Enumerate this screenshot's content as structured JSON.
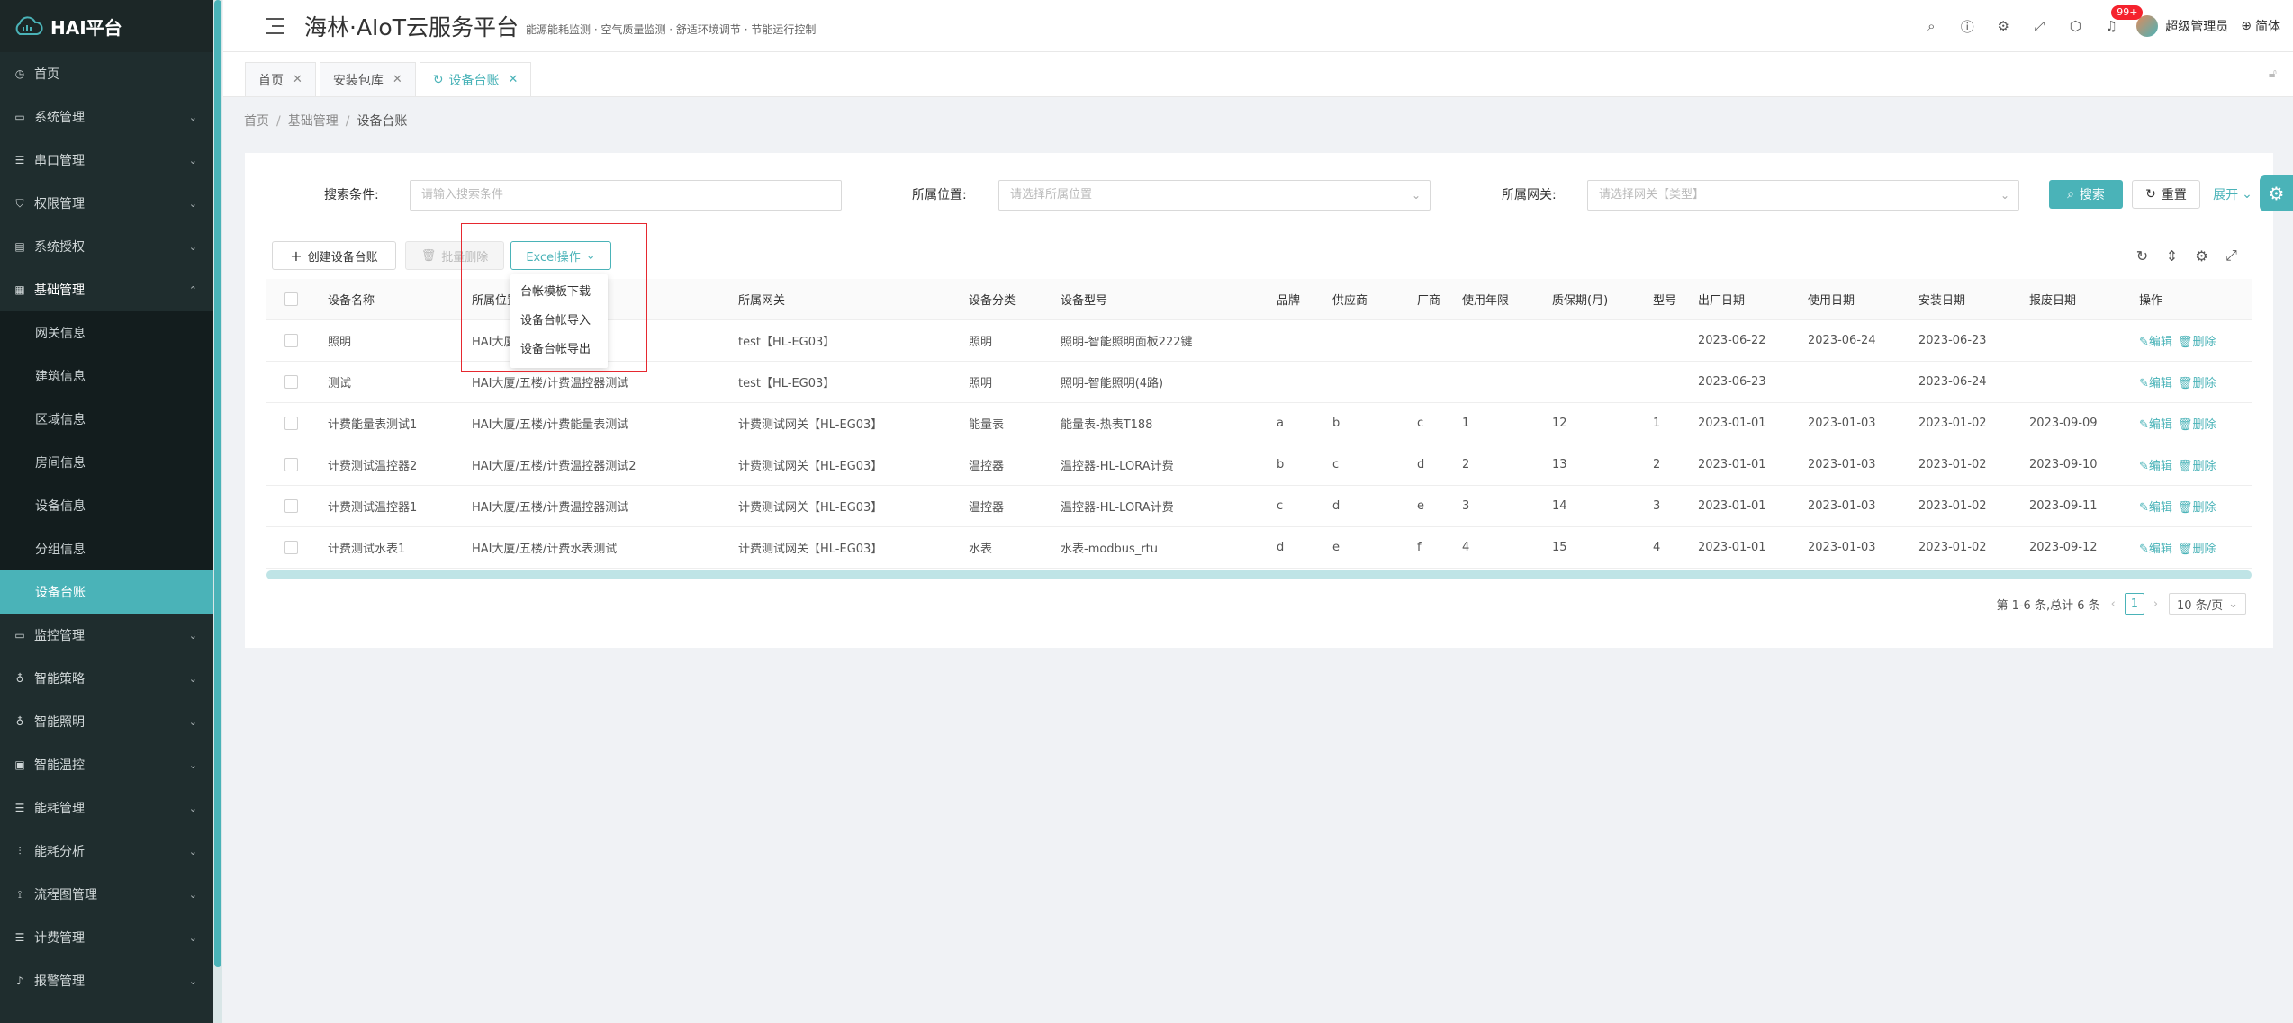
{
  "sidebar": {
    "logo": "HAI平台",
    "items": [
      {
        "label": "首页",
        "icon": "clock-icon",
        "has_arrow": false
      },
      {
        "label": "系统管理",
        "icon": "monitor-icon",
        "has_arrow": true
      },
      {
        "label": "串口管理",
        "icon": "sliders-icon",
        "has_arrow": true
      },
      {
        "label": "权限管理",
        "icon": "shield-icon",
        "has_arrow": true
      },
      {
        "label": "系统授权",
        "icon": "server-icon",
        "has_arrow": true
      },
      {
        "label": "基础管理",
        "icon": "database-icon",
        "has_arrow": true,
        "open": true
      }
    ],
    "submenu": [
      "网关信息",
      "建筑信息",
      "区域信息",
      "房间信息",
      "设备信息",
      "分组信息",
      "设备台账"
    ],
    "active_submenu": "设备台账",
    "items_after": [
      {
        "label": "监控管理",
        "icon": "monitor-icon"
      },
      {
        "label": "智能策略",
        "icon": "bulb-icon"
      },
      {
        "label": "智能照明",
        "icon": "bulb-icon"
      },
      {
        "label": "智能温控",
        "icon": "thermo-icon"
      },
      {
        "label": "能耗管理",
        "icon": "sliders-icon"
      },
      {
        "label": "能耗分析",
        "icon": "chart-icon"
      },
      {
        "label": "流程图管理",
        "icon": "flow-icon"
      },
      {
        "label": "计费管理",
        "icon": "sliders-icon"
      },
      {
        "label": "报警管理",
        "icon": "bell-icon"
      }
    ]
  },
  "header": {
    "title": "海林·AIoT云服务平台",
    "subtitle": "能源能耗监测 · 空气质量监测 · 舒适环境调节 · 节能运行控制",
    "badge": "99+",
    "user": "超级管理员",
    "lang": "简体"
  },
  "tabs": [
    {
      "label": "首页",
      "active": false
    },
    {
      "label": "安装包库",
      "active": false
    },
    {
      "label": "设备台账",
      "active": true
    }
  ],
  "breadcrumb": [
    "首页",
    "基础管理",
    "设备台账"
  ],
  "search": {
    "label1": "搜索条件:",
    "placeholder1": "请输入搜索条件",
    "label2": "所属位置:",
    "placeholder2": "请选择所属位置",
    "label3": "所属网关:",
    "placeholder3": "请选择网关【类型】",
    "search_btn": "搜索",
    "reset_btn": "重置",
    "expand": "展开"
  },
  "toolbar": {
    "create": "创建设备台账",
    "batch_delete": "批量删除",
    "excel": "Excel操作"
  },
  "excel_menu": [
    "台帐模板下载",
    "设备台帐导入",
    "设备台帐导出"
  ],
  "table": {
    "headers": [
      "设备名称",
      "所属位置",
      "所属网关",
      "设备分类",
      "设备型号",
      "品牌",
      "供应商",
      "厂商",
      "使用年限",
      "质保期(月)",
      "型号",
      "出厂日期",
      "使用日期",
      "安装日期",
      "报废日期",
      "操作"
    ],
    "edit_label": "编辑",
    "delete_label": "删除",
    "rows": [
      [
        "照明",
        "HAI大厦",
        "test【HL-EG03】",
        "照明",
        "照明-智能照明面板222键",
        "",
        "",
        "",
        "",
        "",
        "",
        "2023-06-22",
        "2023-06-24",
        "2023-06-23",
        ""
      ],
      [
        "测试",
        "HAI大厦/五楼/计费温控器测试",
        "test【HL-EG03】",
        "照明",
        "照明-智能照明(4路)",
        "",
        "",
        "",
        "",
        "",
        "",
        "2023-06-23",
        "",
        "2023-06-24",
        ""
      ],
      [
        "计费能量表测试1",
        "HAI大厦/五楼/计费能量表测试",
        "计费测试网关【HL-EG03】",
        "能量表",
        "能量表-热表T188",
        "a",
        "b",
        "c",
        "1",
        "12",
        "1",
        "2023-01-01",
        "2023-01-03",
        "2023-01-02",
        "2023-09-09"
      ],
      [
        "计费测试温控器2",
        "HAI大厦/五楼/计费温控器测试2",
        "计费测试网关【HL-EG03】",
        "温控器",
        "温控器-HL-LORA计费",
        "b",
        "c",
        "d",
        "2",
        "13",
        "2",
        "2023-01-01",
        "2023-01-03",
        "2023-01-02",
        "2023-09-10"
      ],
      [
        "计费测试温控器1",
        "HAI大厦/五楼/计费温控器测试",
        "计费测试网关【HL-EG03】",
        "温控器",
        "温控器-HL-LORA计费",
        "c",
        "d",
        "e",
        "3",
        "14",
        "3",
        "2023-01-01",
        "2023-01-03",
        "2023-01-02",
        "2023-09-11"
      ],
      [
        "计费测试水表1",
        "HAI大厦/五楼/计费水表测试",
        "计费测试网关【HL-EG03】",
        "水表",
        "水表-modbus_rtu",
        "d",
        "e",
        "f",
        "4",
        "15",
        "4",
        "2023-01-01",
        "2023-01-03",
        "2023-01-02",
        "2023-09-12"
      ]
    ]
  },
  "pagination": {
    "summary": "第 1-6 条,总计 6 条",
    "current": "1",
    "page_size": "10 条/页"
  },
  "colors": {
    "accent": "#4ab3b8",
    "sidebar_bg": "#1f2d2e",
    "highlight_box": "#e6282f",
    "badge": "#f5222d"
  }
}
